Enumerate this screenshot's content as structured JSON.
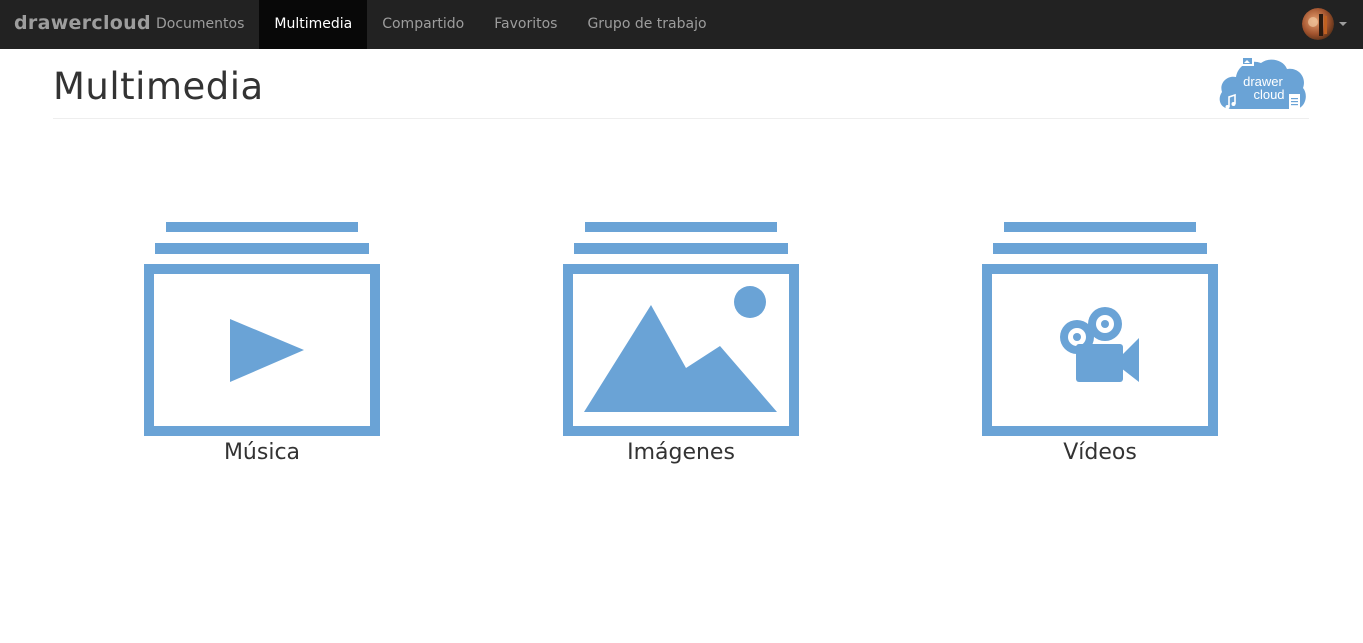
{
  "navbar": {
    "brand": "drawercloud",
    "items": [
      {
        "label": "Documentos",
        "active": false
      },
      {
        "label": "Multimedia",
        "active": true
      },
      {
        "label": "Compartido",
        "active": false
      },
      {
        "label": "Favoritos",
        "active": false
      },
      {
        "label": "Grupo de trabajo",
        "active": false
      }
    ],
    "user_icon": "avatar",
    "menu_icon": "caret-down-icon"
  },
  "page": {
    "title": "Multimedia",
    "logo": {
      "line1": "drawer",
      "line2": "cloud"
    }
  },
  "tiles": [
    {
      "label": "Música",
      "icon": "play-icon"
    },
    {
      "label": "Imágenes",
      "icon": "image-icon"
    },
    {
      "label": "Vídeos",
      "icon": "video-camera-icon"
    }
  ],
  "colors": {
    "accent": "#6aa3d6",
    "navbar_bg": "#222222",
    "navbar_active_bg": "#080808",
    "navbar_text": "#9d9d9d"
  }
}
